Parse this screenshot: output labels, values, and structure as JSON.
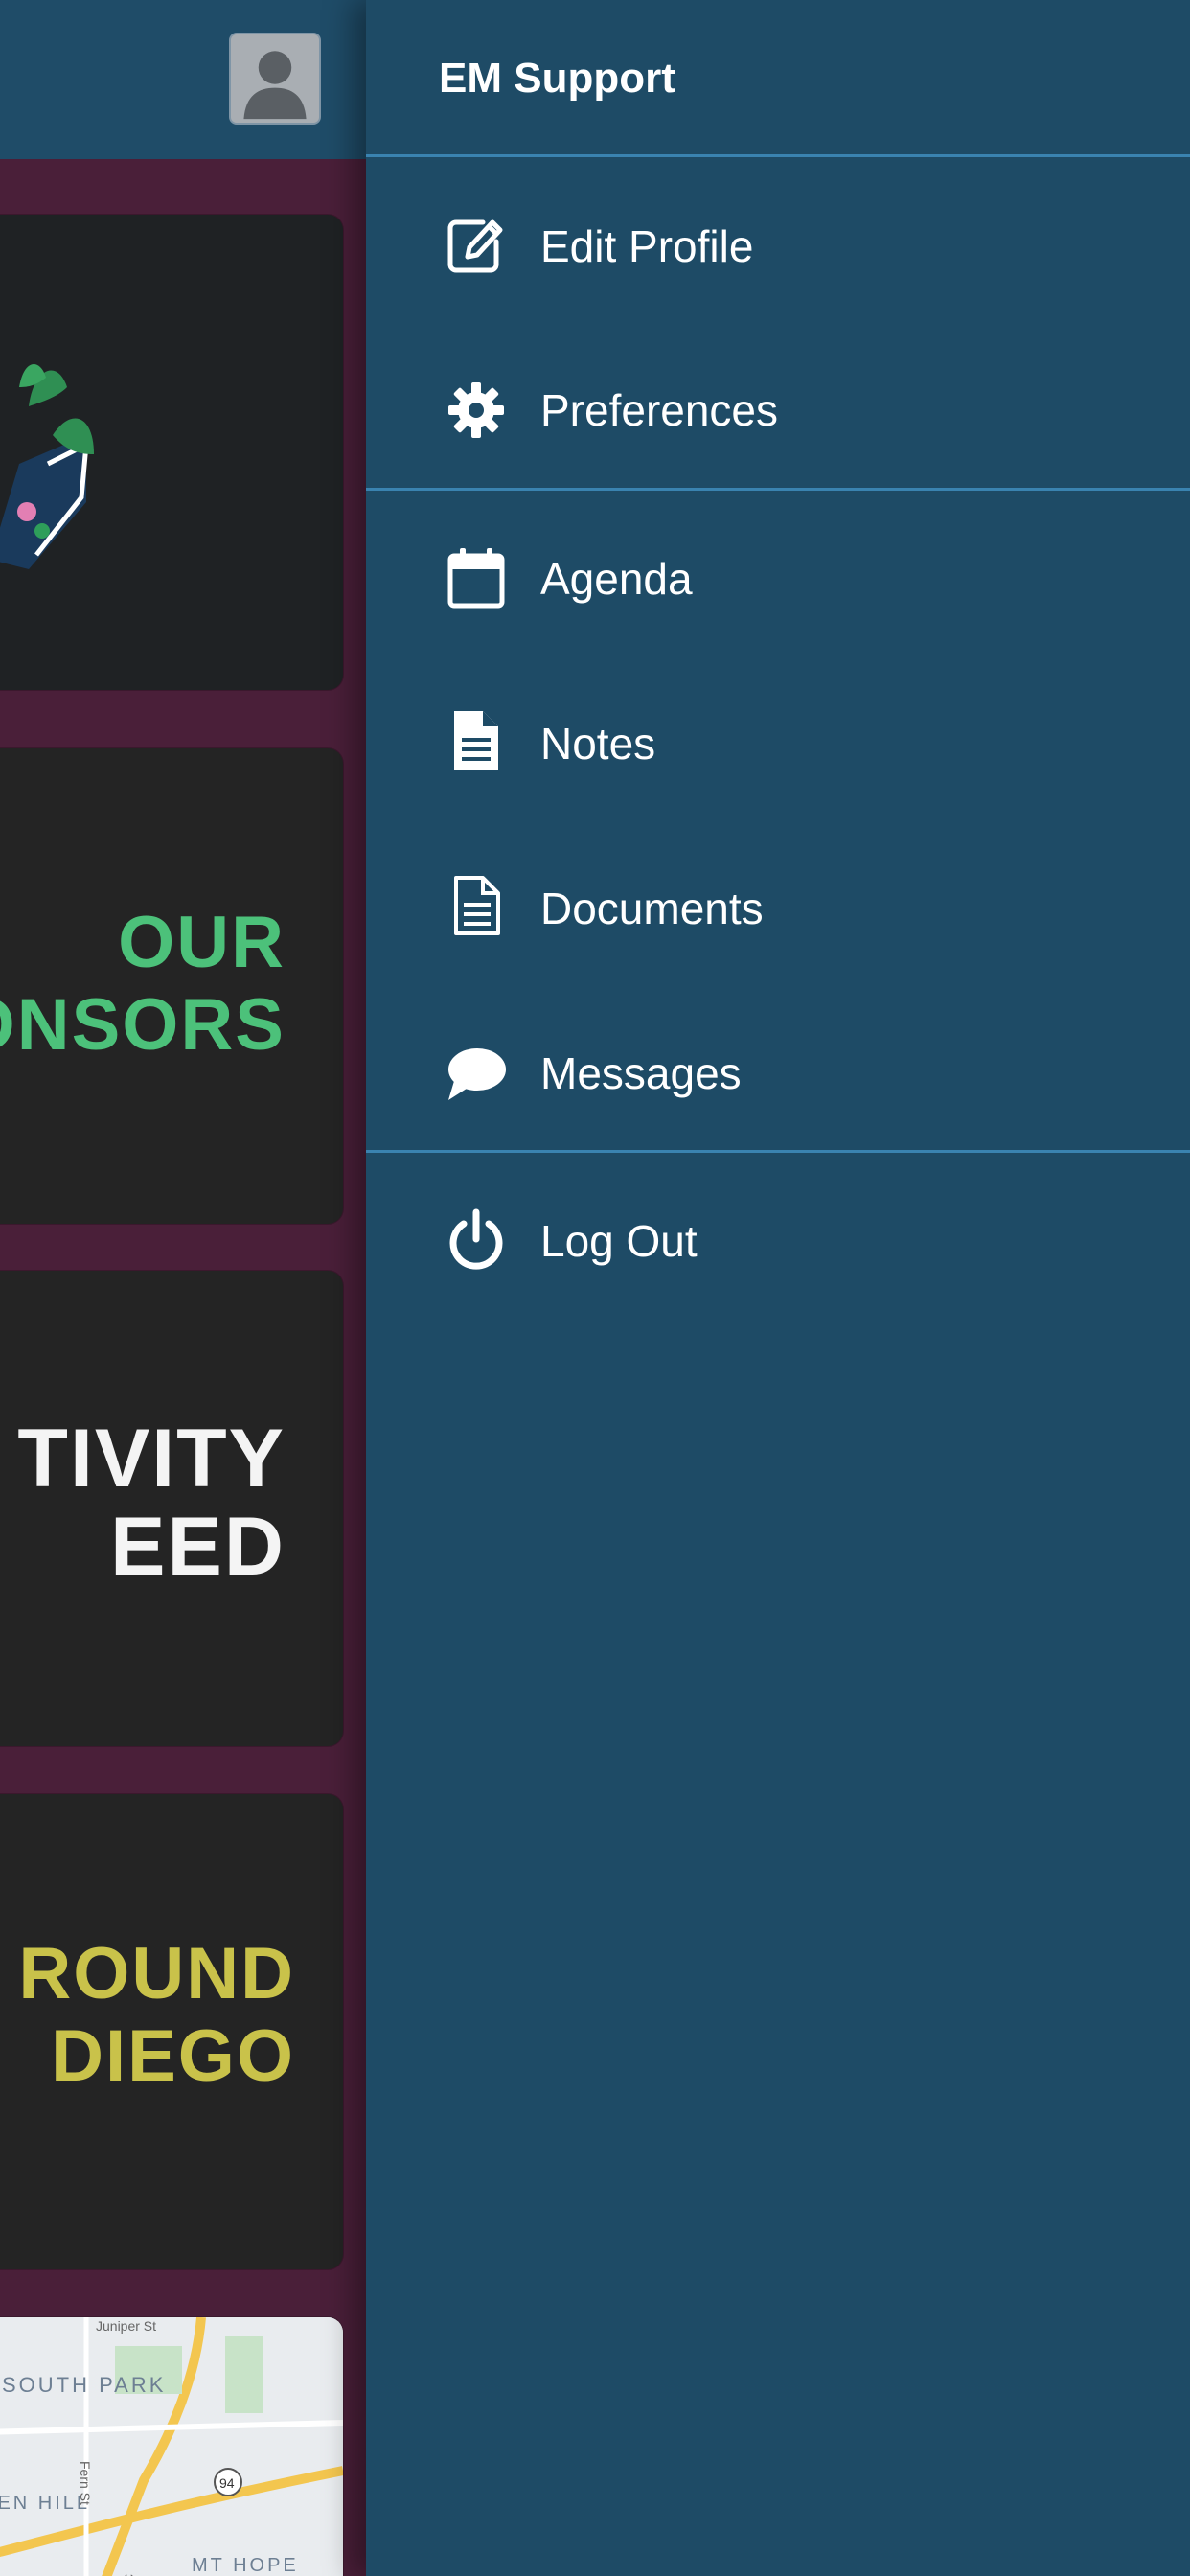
{
  "drawer": {
    "title": "EM Support",
    "menu": [
      {
        "label": "Edit Profile",
        "icon": "edit-icon"
      },
      {
        "label": "Preferences",
        "icon": "gear-icon"
      },
      {
        "label": "Agenda",
        "icon": "calendar-icon"
      },
      {
        "label": "Notes",
        "icon": "note-icon"
      },
      {
        "label": "Documents",
        "icon": "document-icon"
      },
      {
        "label": "Messages",
        "icon": "chat-bubble-icon"
      },
      {
        "label": "Log Out",
        "icon": "power-icon"
      }
    ]
  },
  "background": {
    "tiles": [
      {
        "line1": "OUR",
        "line2": "ONSORS"
      },
      {
        "line1": "TIVITY",
        "line2": "EED"
      },
      {
        "line1": "ROUND",
        "line2": "DIEGO"
      }
    ],
    "map_labels": [
      "Juniper St",
      "SOUTH PARK",
      "Fern St",
      "ge",
      "DEN HILL",
      "94",
      "MT HOPE",
      "32n"
    ]
  },
  "colors": {
    "drawer_bg": "#1e4b66",
    "divider": "#3a83b0",
    "header_bg": "#1f4c68",
    "page_bg": "#4a1f39",
    "sponsors_text": "#4cc17a",
    "activity_text": "#f4f4f4",
    "around_text": "#c9c24a"
  }
}
